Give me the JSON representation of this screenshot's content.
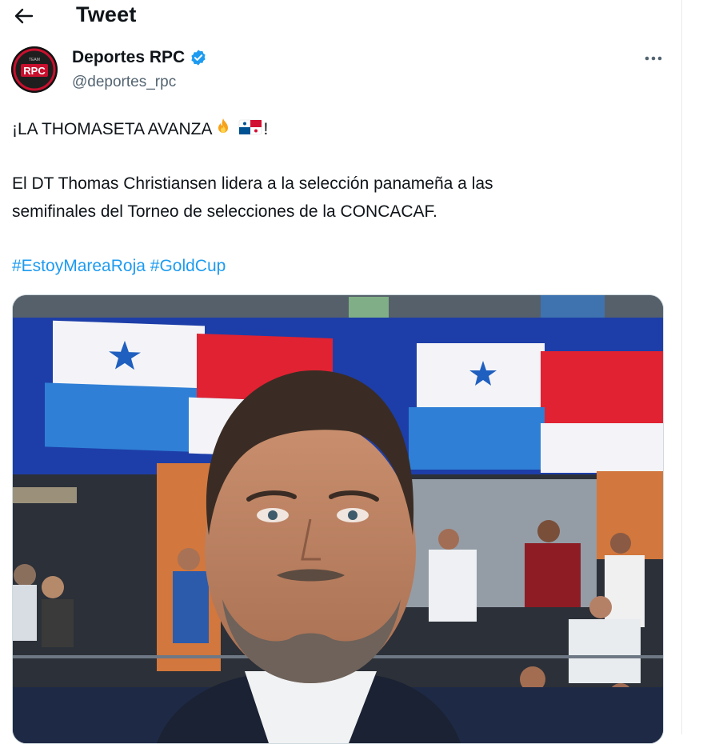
{
  "header": {
    "title": "Tweet",
    "back_icon": "arrow-left-icon"
  },
  "author": {
    "name": "Deportes RPC",
    "handle": "@deportes_rpc",
    "verified": true,
    "avatar_text": "RPC",
    "avatar_top_text": "TEAM"
  },
  "tweet": {
    "line1": "¡LA THOMASETA AVANZA",
    "line1_end": "!",
    "body_line1": "El DT Thomas Christiansen lidera a la selección panameña a las",
    "body_line2": "semifinales del Torneo de selecciones de la CONCACAF.",
    "hashtags": [
      "#EstoyMareaRoja",
      "#GoldCup"
    ],
    "emojis": [
      "fire-icon",
      "panama-flag-icon"
    ]
  },
  "media": {
    "description_icon": "photo"
  },
  "colors": {
    "accent": "#1d9bf0",
    "text": "#0f1419",
    "secondary": "#536471",
    "verified": "#1d9bf0"
  }
}
